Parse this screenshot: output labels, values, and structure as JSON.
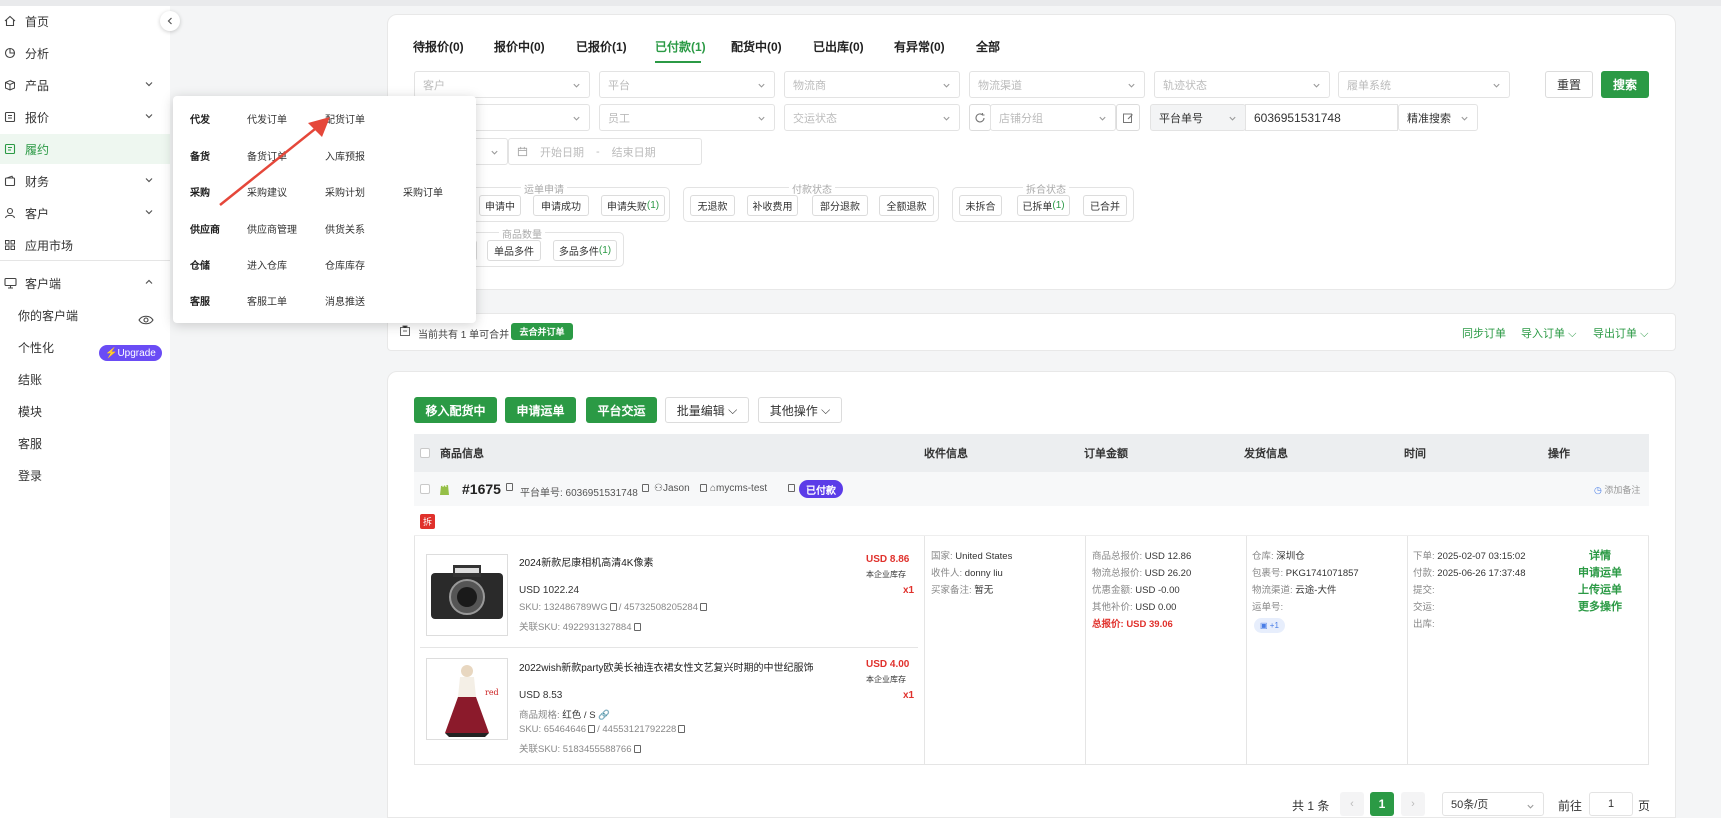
{
  "sidebar": {
    "items": [
      {
        "label": "首页",
        "icon": "home-icon"
      },
      {
        "label": "分析",
        "icon": "chart-icon"
      },
      {
        "label": "产品",
        "icon": "box-icon"
      },
      {
        "label": "报价",
        "icon": "quote-icon"
      },
      {
        "label": "履约",
        "icon": "fulfillment-icon"
      },
      {
        "label": "财务",
        "icon": "wallet-icon"
      },
      {
        "label": "客户",
        "icon": "user-icon"
      },
      {
        "label": "应用市场",
        "icon": "apps-icon"
      }
    ],
    "client_section": "客户端",
    "sub_items": [
      "你的客户端",
      "个性化",
      "结账",
      "模块",
      "客服",
      "登录"
    ],
    "upgrade_label": "Upgrade"
  },
  "tabs": [
    "待报价(0)",
    "报价中(0)",
    "已报价(1)",
    "已付款(1)",
    "配货中(0)",
    "已出库(0)",
    "有异常(0)",
    "全部"
  ],
  "filters": {
    "row1": [
      "客户",
      "平台",
      "物流商",
      "物流渠道",
      "轨迹状态",
      "履单系统"
    ],
    "row2": [
      "员工",
      "交运状态",
      "店铺分组"
    ],
    "platform_no_label": "平台单号",
    "search_value": "6036951531748",
    "precise_search": "精准搜索",
    "date_start": "开始日期",
    "date_sep": "-",
    "date_end": "结束日期",
    "reset": "重置",
    "search": "搜索"
  },
  "filter_groups": {
    "waybill": {
      "title": "运单申请",
      "chips": [
        "申请中",
        "申请成功",
        "申请失败"
      ],
      "fail_count": "(1)"
    },
    "payment": {
      "title": "付款状态",
      "chips": [
        "无退款",
        "补收费用",
        "部分退款",
        "全额退款"
      ]
    },
    "merge": {
      "title": "拆合状态",
      "chips": [
        "未拆合",
        "已拆单",
        "已合并"
      ],
      "split_count": "(1)"
    },
    "qty": {
      "title": "商品数量",
      "chips": [
        "单品多件",
        "多品多件"
      ],
      "multi_count": "(1)"
    }
  },
  "popup_menu": [
    {
      "head": "代发",
      "items": [
        "代发订单",
        "配货订单"
      ]
    },
    {
      "head": "备货",
      "items": [
        "备货订单",
        "入库预报"
      ]
    },
    {
      "head": "采购",
      "items": [
        "采购建议",
        "采购计划",
        "采购订单"
      ]
    },
    {
      "head": "供应商",
      "items": [
        "供应商管理",
        "供货关系"
      ]
    },
    {
      "head": "仓储",
      "items": [
        "进入仓库",
        "仓库库存"
      ]
    },
    {
      "head": "客服",
      "items": [
        "客服工单",
        "消息推送"
      ]
    }
  ],
  "merge_bar": {
    "text": "当前共有 1 单可合并",
    "merge_btn": "去合并订单",
    "sync": "同步订单",
    "import": "导入订单",
    "export": "导出订单"
  },
  "actions": [
    "移入配货中",
    "申请运单",
    "平台交运",
    "批量编辑",
    "其他操作"
  ],
  "table_headers": [
    "商品信息",
    "收件信息",
    "订单金额",
    "发货信息",
    "时间",
    "操作"
  ],
  "order": {
    "id": "#1675",
    "platform_no": "平台单号: 6036951531748",
    "user": "Jason",
    "shop": "mycms-test",
    "status": "已付款",
    "add_note": "添加备注",
    "split_tag": "拆",
    "products": [
      {
        "title": "2024新款尼康相机高清4K像素",
        "price": "USD 1022.24",
        "sku": "SKU: 132486789WG",
        "sku2": "45732508205284",
        "related": "关联SKU: 4922931327884",
        "unit_price": "USD 8.86",
        "stock": "本企业库存",
        "qty": "x1"
      },
      {
        "title": "2022wish新款party欧美长袖连衣裙女性文艺复兴时期的中世纪服饰",
        "price": "USD 8.53",
        "spec_label": "商品规格:",
        "spec": "红色 / S",
        "sku": "SKU: 65464646",
        "sku2": "44553121792228",
        "related": "关联SKU: 5183455588766",
        "unit_price": "USD 4.00",
        "stock": "本企业库存",
        "qty": "x1"
      }
    ],
    "recipient": {
      "country_label": "国家:",
      "country": "United States",
      "name_label": "收件人:",
      "name": "donny liu",
      "note_label": "买家备注:",
      "note": "暂无"
    },
    "amount": [
      {
        "label": "商品总报价:",
        "value": "USD 12.86"
      },
      {
        "label": "物流总报价:",
        "value": "USD 26.20"
      },
      {
        "label": "优惠金额:",
        "value": "USD -0.00"
      },
      {
        "label": "其他补价:",
        "value": "USD 0.00"
      },
      {
        "label": "总报价:",
        "value": "USD 39.06"
      }
    ],
    "shipping": [
      {
        "label": "仓库:",
        "value": "深圳仓"
      },
      {
        "label": "包裹号:",
        "value": "PKG1741071857"
      },
      {
        "label": "物流渠道:",
        "value": "云途-大件"
      },
      {
        "label": "运单号:",
        "value": ""
      }
    ],
    "package_badge": "+1",
    "times": [
      {
        "label": "下单:",
        "value": "2025-02-07 03:15:02"
      },
      {
        "label": "付款:",
        "value": "2025-06-26 17:37:48"
      },
      {
        "label": "提交:",
        "value": ""
      },
      {
        "label": "交运:",
        "value": ""
      },
      {
        "label": "出库:",
        "value": ""
      }
    ],
    "ops": [
      "详情",
      "申请运单",
      "上传运单",
      "更多操作"
    ]
  },
  "pagination": {
    "total": "共 1 条",
    "current": "1",
    "page_size": "50条/页",
    "goto_label": "前往",
    "goto_value": "1",
    "page_suffix": "页"
  },
  "colors": {
    "accent": "#2b9a45",
    "badge": "#5b3ce8",
    "price": "#e0312c",
    "arrow": "#e5473a"
  }
}
